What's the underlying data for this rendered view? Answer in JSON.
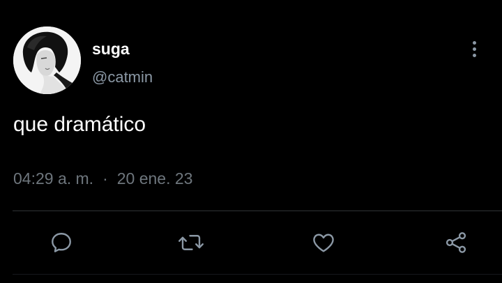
{
  "tweet": {
    "display_name": "suga",
    "handle": "@catmin",
    "text": "que dramático",
    "time": "04:29 a. m.",
    "separator": "·",
    "date": "20 ene. 23"
  },
  "actions": {
    "reply": "reply-icon",
    "retweet": "retweet-icon",
    "like": "heart-icon",
    "share": "share-icon"
  },
  "colors": {
    "background": "#000000",
    "text": "#ffffff",
    "secondary": "#8b98a5",
    "icon": "#8b98a5",
    "divider": "#2f3336"
  }
}
